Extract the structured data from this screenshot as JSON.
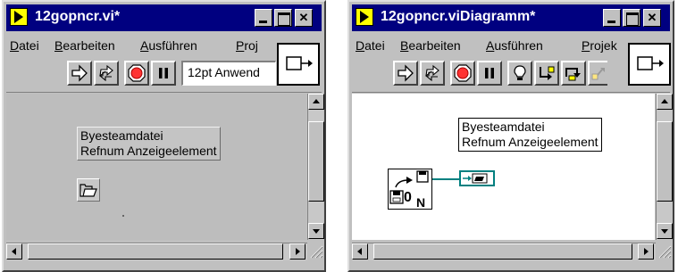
{
  "front_panel": {
    "title": "12gopncr.vi*",
    "menu": [
      {
        "underline": "D",
        "rest": "atei"
      },
      {
        "underline": "B",
        "rest": "earbeiten"
      },
      {
        "underline": "A",
        "rest": "usführen"
      },
      {
        "underline": "P",
        "rest": "roj"
      }
    ],
    "font_ring": "12pt Anwend",
    "control_label_line1": "Byesteamdatei",
    "control_label_line2": "Refnum Anzeigeelement"
  },
  "block_diagram": {
    "title": "12gopncr.viDiagramm*",
    "menu": [
      {
        "underline": "D",
        "rest": "atei"
      },
      {
        "underline": "B",
        "rest": "earbeiten"
      },
      {
        "underline": "A",
        "rest": "usführen"
      },
      {
        "underline": "P",
        "rest": "rojek"
      }
    ],
    "terminal_label_line1": "Byesteamdatei",
    "terminal_label_line2": "Refnum Anzeigeelement",
    "node_text": "0",
    "node_subscript": "N"
  },
  "icons": {
    "run_arrow": "run-arrow-icon",
    "continuous": "run-continuously-icon",
    "abort": "abort-icon",
    "pause": "pause-icon",
    "highlight": "highlight-execution-icon",
    "connector": "connector-pane-icon",
    "file_refnum": "file-refnum-icon"
  },
  "colors": {
    "titlebar": "#000080",
    "window": "#c0c0c0",
    "front_pane": "#bdbdbd",
    "wire": "#008080"
  }
}
